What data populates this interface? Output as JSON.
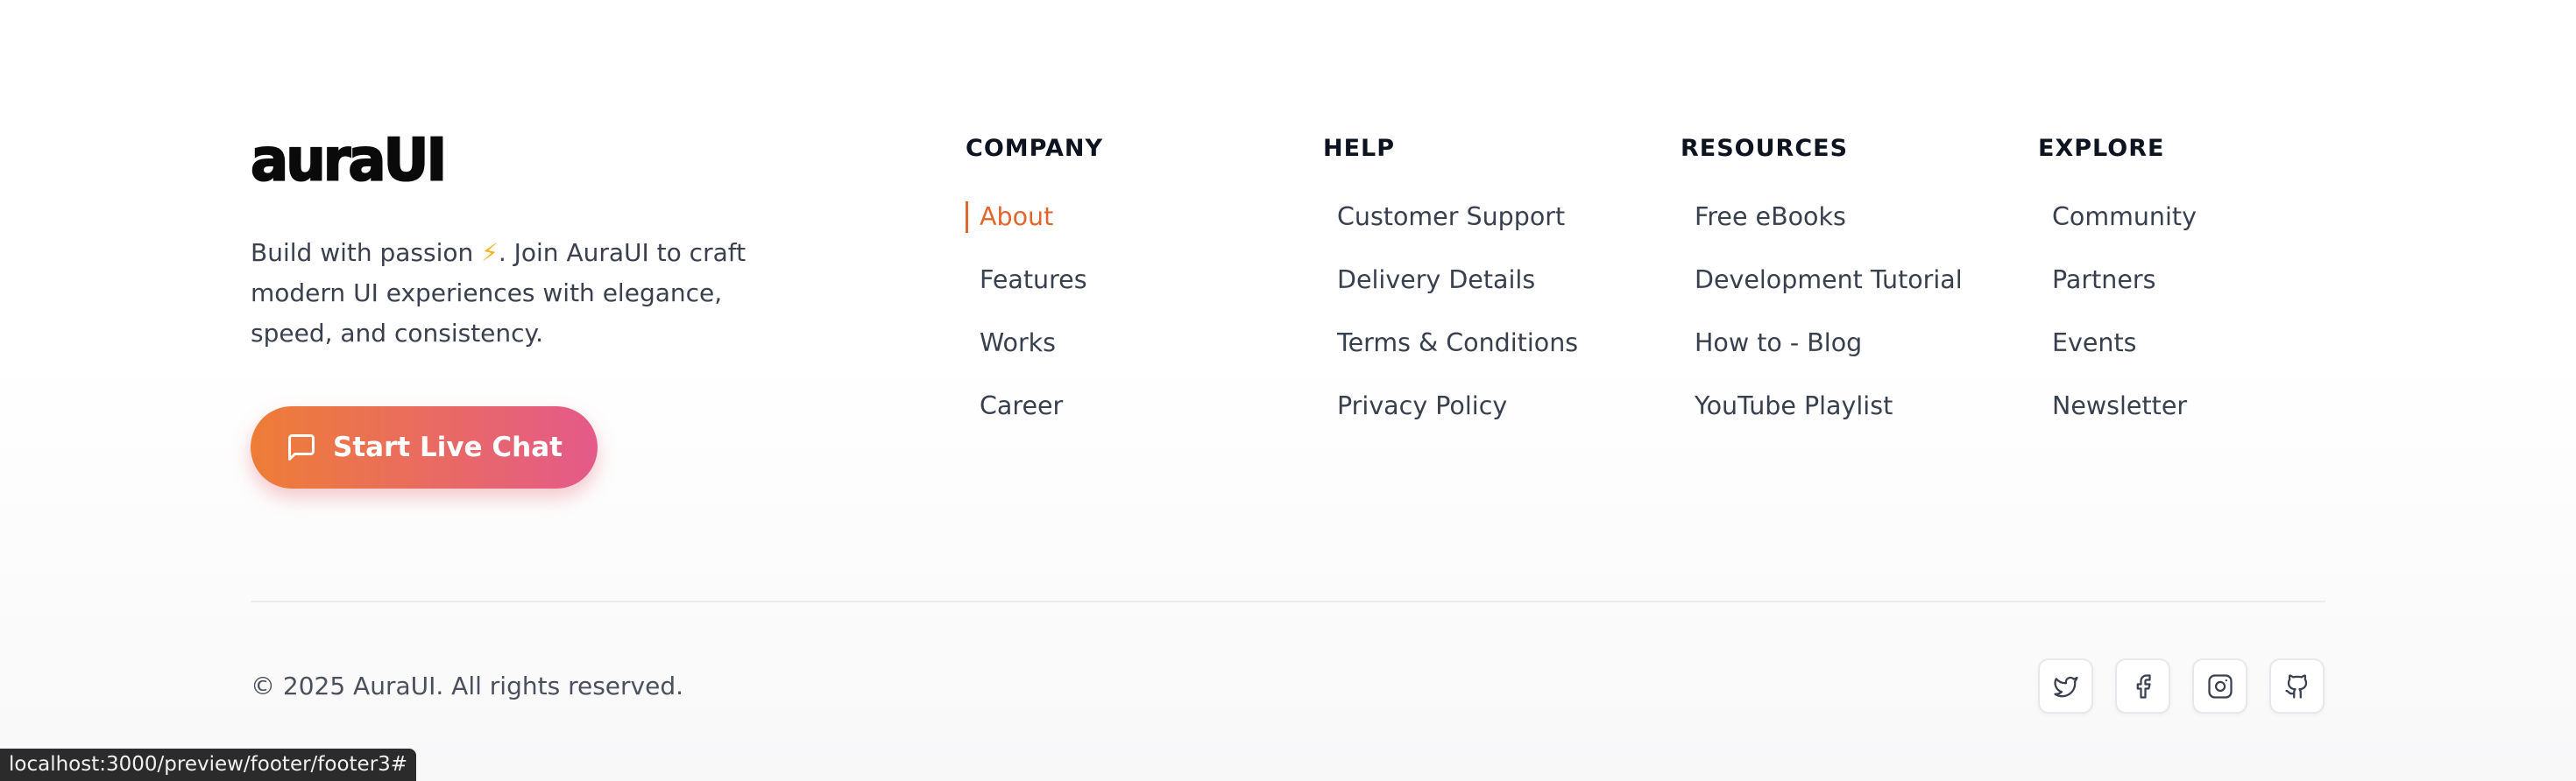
{
  "brand": {
    "logo_text": "auraUI",
    "tagline_before": "Build with passion ",
    "tagline_bolt": "⚡",
    "tagline_after": ". Join AuraUI to craft modern UI experiences with elegance, speed, and consistency.",
    "chat_button_label": "Start Live Chat",
    "chat_icon": "message-square-icon",
    "button_gradient": [
      "#ee7d36",
      "#e45a8a"
    ]
  },
  "columns": [
    {
      "heading": "COMPANY",
      "links": [
        "About",
        "Features",
        "Works",
        "Career"
      ],
      "active_index": 0
    },
    {
      "heading": "HELP",
      "links": [
        "Customer Support",
        "Delivery Details",
        "Terms & Conditions",
        "Privacy Policy"
      ]
    },
    {
      "heading": "RESOURCES",
      "links": [
        "Free eBooks",
        "Development Tutorial",
        "How to - Blog",
        "YouTube Playlist"
      ]
    },
    {
      "heading": "EXPLORE",
      "links": [
        "Community",
        "Partners",
        "Events",
        "Newsletter"
      ]
    }
  ],
  "accent_color": "#e0662c",
  "bottom": {
    "copyright": "© 2025 AuraUI. All rights reserved.",
    "socials": [
      "twitter-icon",
      "facebook-icon",
      "instagram-icon",
      "github-icon"
    ]
  },
  "status_bar": {
    "url": "localhost:3000/preview/footer/footer3#"
  }
}
